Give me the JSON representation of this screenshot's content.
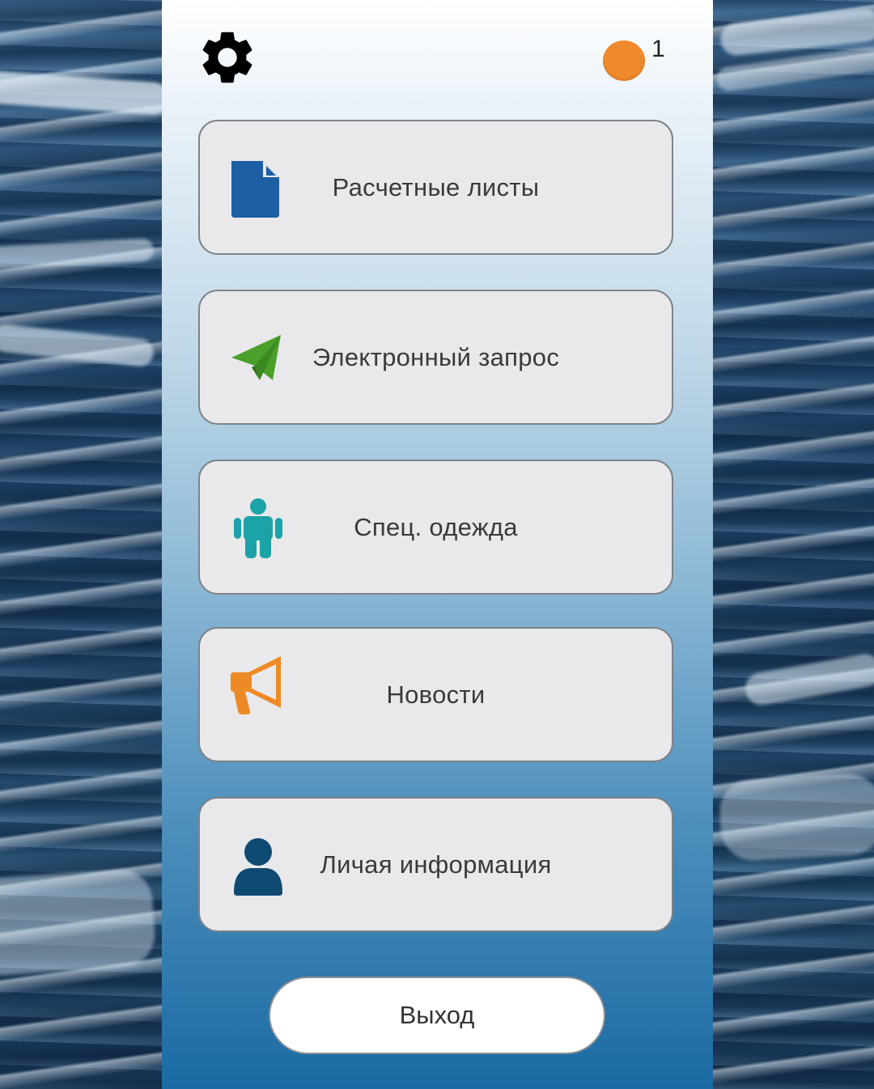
{
  "header": {
    "settings_icon": "gear-icon",
    "notification_count": "1",
    "notification_color": "#f0892b"
  },
  "menu": {
    "items": [
      {
        "label": "Расчетные листы",
        "icon": "document-icon",
        "icon_color": "#1d5fa3"
      },
      {
        "label": "Электронный запрос",
        "icon": "paper-plane-icon",
        "icon_color": "#4aa02a"
      },
      {
        "label": "Спец. одежда",
        "icon": "person-figure-icon",
        "icon_color": "#1ba3a8"
      },
      {
        "label": "Новости",
        "icon": "megaphone-icon",
        "icon_color": "#ee8a25"
      },
      {
        "label": "Личая информация",
        "icon": "user-icon",
        "icon_color": "#0f4a72"
      }
    ]
  },
  "footer": {
    "logout_label": "Выход"
  }
}
